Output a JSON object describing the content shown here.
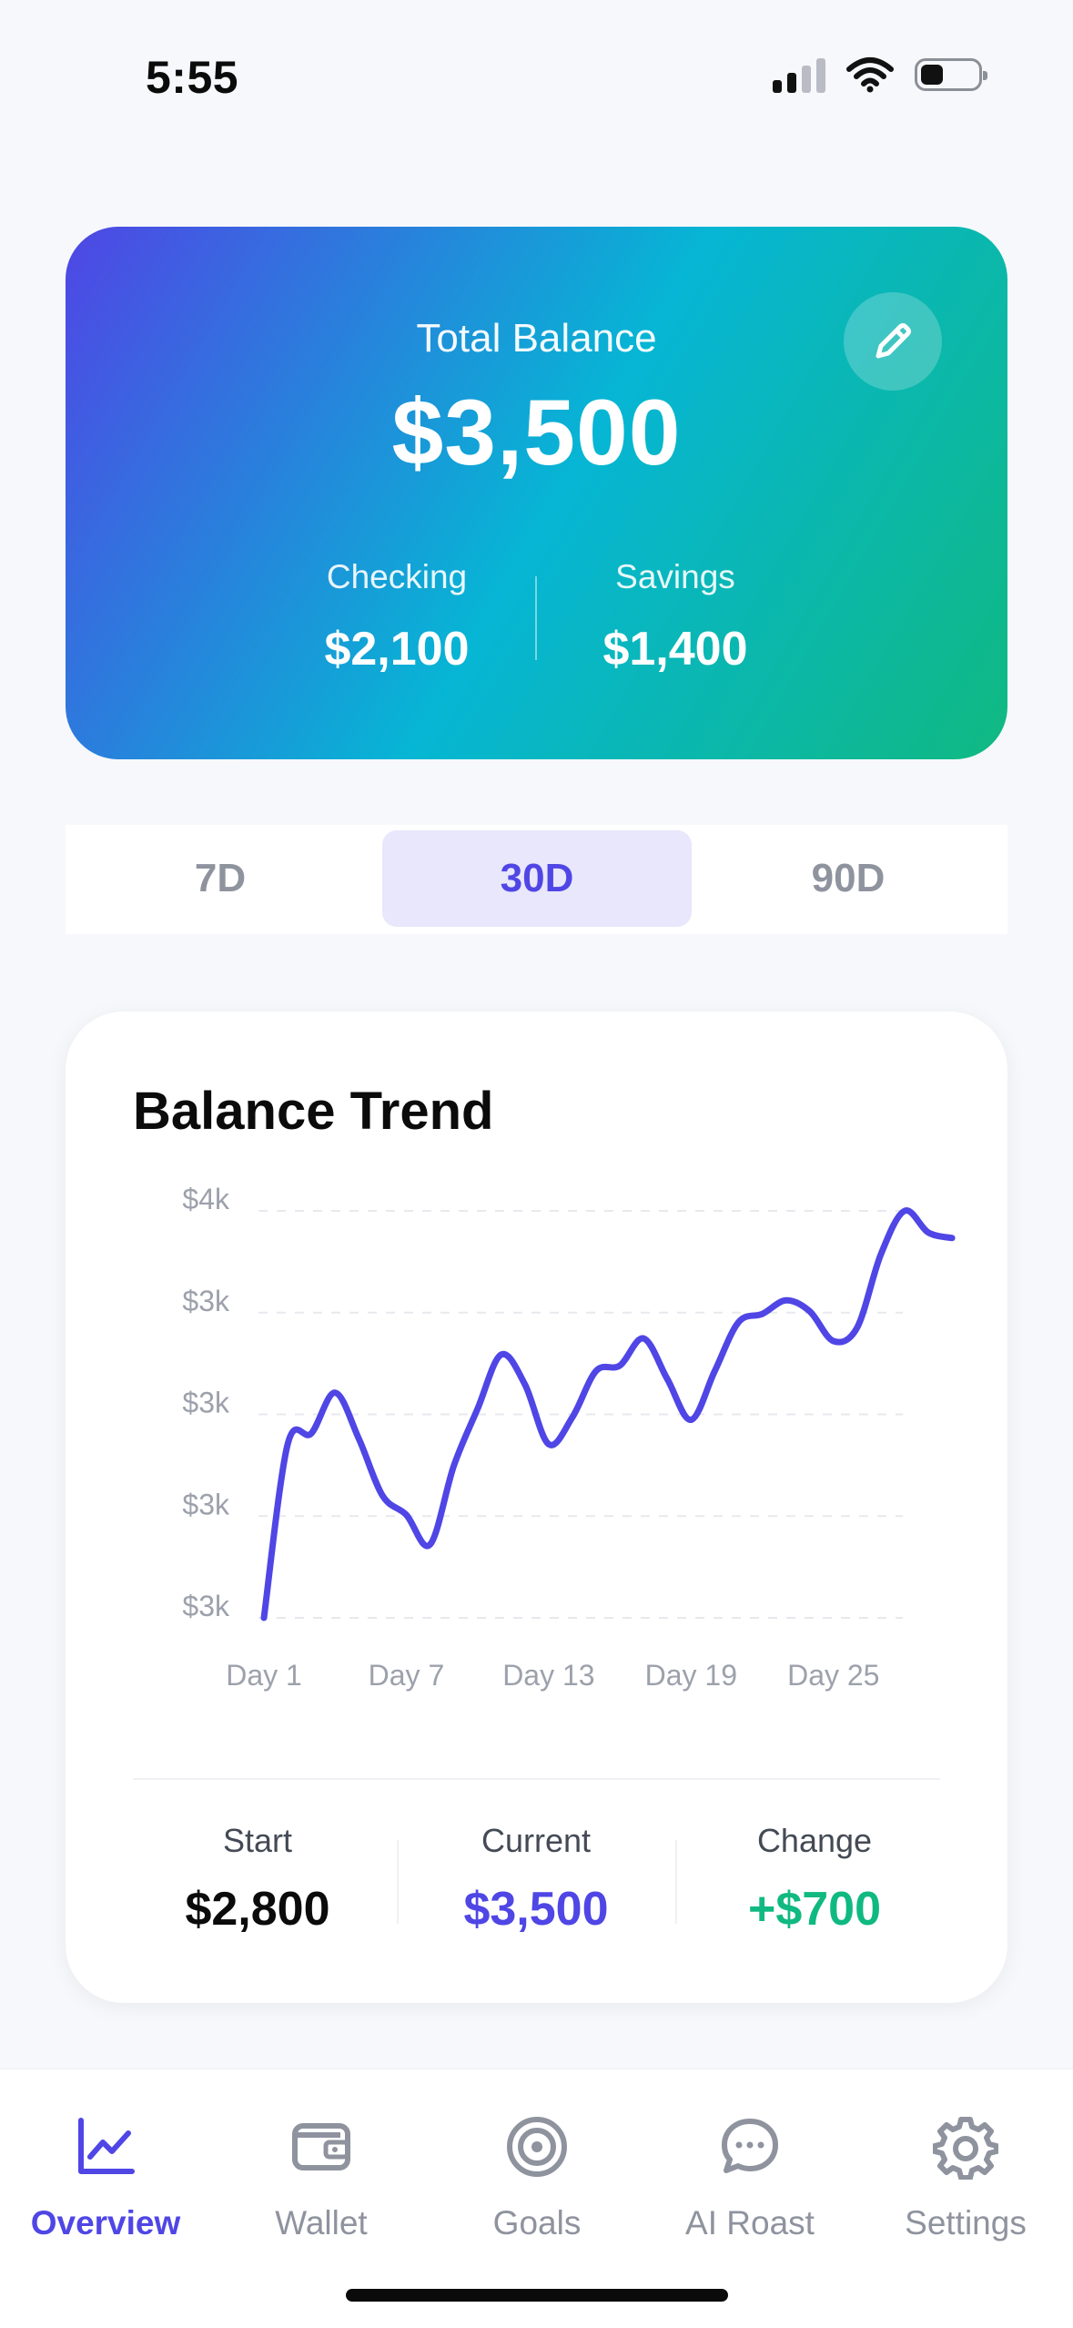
{
  "status": {
    "time": "5:55"
  },
  "balance_card": {
    "label": "Total Balance",
    "amount": "$3,500",
    "checking_label": "Checking",
    "checking_value": "$2,100",
    "savings_label": "Savings",
    "savings_value": "$1,400"
  },
  "range_tabs": [
    "7D",
    "30D",
    "90D"
  ],
  "selected_range": "30D",
  "trend": {
    "title": "Balance Trend",
    "start_label": "Start",
    "start_value": "$2,800",
    "current_label": "Current",
    "current_value": "$3,500",
    "change_label": "Change",
    "change_value": "+$700"
  },
  "chart_data": {
    "type": "line",
    "ylim": [
      2800,
      3550
    ],
    "y_tick_values": [
      2800,
      2987.5,
      3175,
      3362.5,
      3550
    ],
    "y_tick_labels": [
      "$3k",
      "$3k",
      "$3k",
      "$3k",
      "$4k"
    ],
    "x_tick_labels": [
      "Day 1",
      "Day 7",
      "Day 13",
      "Day 19",
      "Day 25"
    ],
    "x_tick_days": [
      1,
      7,
      13,
      19,
      25
    ],
    "grid": true,
    "series": [
      {
        "color": "#4f46e5",
        "x": [
          1,
          2,
          3,
          4,
          5,
          6,
          7,
          8,
          9,
          10,
          11,
          12,
          13,
          14,
          15,
          16,
          17,
          18,
          19,
          20,
          21,
          22,
          23,
          24,
          25,
          26,
          27,
          28,
          29,
          30
        ],
        "values": [
          2800,
          3120,
          3140,
          3215,
          3130,
          3025,
          2990,
          2935,
          3080,
          3185,
          3285,
          3230,
          3120,
          3170,
          3255,
          3265,
          3315,
          3240,
          3165,
          3255,
          3345,
          3360,
          3385,
          3365,
          3310,
          3335,
          3470,
          3550,
          3510,
          3500
        ]
      }
    ]
  },
  "tabs": {
    "overview": "Overview",
    "wallet": "Wallet",
    "goals": "Goals",
    "ai_roast": "AI Roast",
    "settings": "Settings"
  },
  "colors": {
    "accent": "#4f46e5",
    "positive": "#10b981",
    "gradient_start": "#4f46e5",
    "gradient_mid": "#06b6d4",
    "gradient_end": "#10b981"
  }
}
